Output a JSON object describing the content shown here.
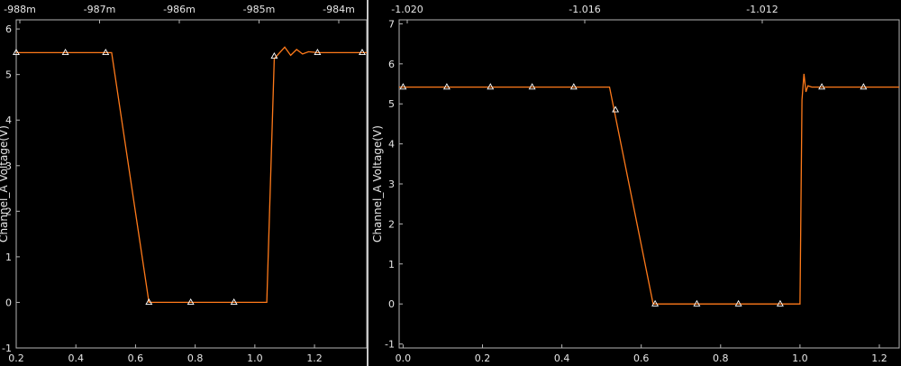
{
  "chart_data": [
    {
      "type": "line",
      "ylabel": "Channel_A Voltage(V)",
      "xlim": [
        0.2,
        1.375
      ],
      "ylim": [
        -1,
        6.2
      ],
      "x_ticks": [
        "0.2",
        "0.4",
        "0.6",
        "0.8",
        "1.0",
        "1.2"
      ],
      "y_ticks": [
        "-1",
        "0",
        "1",
        "2",
        "3",
        "4",
        "5",
        "6"
      ],
      "top_ticks": [
        "-988m",
        "-987m",
        "-986m",
        "-985m",
        "-984m"
      ],
      "series": [
        {
          "color": "#ff7a1a",
          "x": [
            0.2,
            0.52,
            0.645,
            0.7,
            1.04,
            1.065,
            1.1,
            1.12,
            1.14,
            1.16,
            1.18,
            1.21,
            1.375
          ],
          "y": [
            5.48,
            5.48,
            0.0,
            0.0,
            0.0,
            5.35,
            5.6,
            5.42,
            5.55,
            5.45,
            5.5,
            5.48,
            5.48
          ],
          "markers_x": [
            0.2,
            0.365,
            0.5,
            0.645,
            0.785,
            0.93,
            1.065,
            1.21,
            1.36
          ],
          "markers_y": [
            5.48,
            5.48,
            5.48,
            0.0,
            0.0,
            0.0,
            5.4,
            5.48,
            5.48
          ]
        }
      ]
    },
    {
      "type": "line",
      "ylabel": "Channel_A Voltage(V)",
      "xlim": [
        -0.01,
        1.25
      ],
      "ylim": [
        -1.1,
        7.1
      ],
      "x_ticks": [
        "0.0",
        "0.2",
        "0.4",
        "0.6",
        "0.8",
        "1.0",
        "1.2"
      ],
      "y_ticks": [
        "-1",
        "0",
        "1",
        "2",
        "3",
        "4",
        "5",
        "6",
        "7"
      ],
      "top_ticks": [
        "-1.020",
        "-1.016",
        "-1.012"
      ],
      "series": [
        {
          "color": "#ff7a1a",
          "x": [
            -0.01,
            0.52,
            0.63,
            0.64,
            1.0,
            1.005,
            1.01,
            1.015,
            1.02,
            1.03,
            1.25
          ],
          "y": [
            5.42,
            5.42,
            0.0,
            0.0,
            0.0,
            5.1,
            5.75,
            5.3,
            5.45,
            5.42,
            5.42
          ],
          "markers_x": [
            0.0,
            0.11,
            0.22,
            0.325,
            0.43,
            0.535,
            0.635,
            0.74,
            0.845,
            0.95,
            1.055,
            1.16
          ],
          "markers_y": [
            5.42,
            5.42,
            5.42,
            5.42,
            5.42,
            4.85,
            0.0,
            0.0,
            0.0,
            0.0,
            5.42,
            5.42
          ]
        }
      ]
    }
  ]
}
